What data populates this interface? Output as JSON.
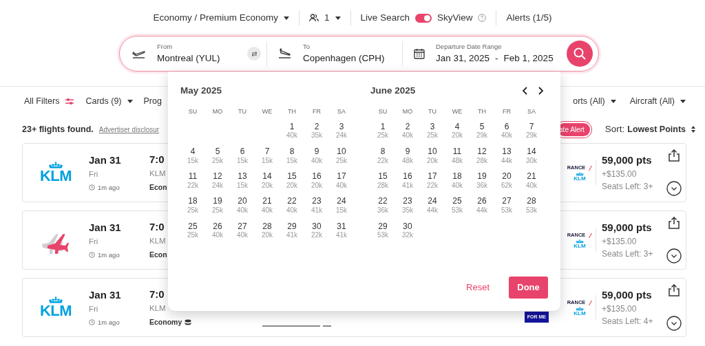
{
  "top_bar": {
    "cabin": "Economy / Premium Economy",
    "passengers": "1",
    "live_search": {
      "label": "Live Search",
      "on": true
    },
    "skyview": "SkyView",
    "alerts": "Alerts (1/5)"
  },
  "search": {
    "from": {
      "label": "From",
      "value": "Montreal (YUL)"
    },
    "to": {
      "label": "To",
      "value": "Copenhagen (CPH)"
    },
    "dates": {
      "label": "Departure Date Range",
      "start": "Jan 31, 2025",
      "separator": "-",
      "end": "Feb 1, 2025"
    }
  },
  "filters_left": [
    {
      "label": "All Filters",
      "kind": "filters"
    },
    {
      "label": "Cards (9)",
      "kind": "dropdown"
    },
    {
      "label": "Prog",
      "kind": "link"
    }
  ],
  "filters_right": [
    {
      "label": "orts (All)",
      "kind": "dropdown"
    },
    {
      "label": "Aircraft (All)",
      "kind": "dropdown"
    }
  ],
  "results": {
    "count": "23+ flights found.",
    "disclosure": "Advertiser disclosur",
    "alert_button": "ate Alert",
    "sort_label": "Sort:",
    "sort_value": "Lowest Points"
  },
  "flights": [
    {
      "kind": "wordmark",
      "logo_text": "KLM",
      "date": "Jan 31",
      "day": "Fri",
      "updated": "1m ago",
      "time": "7:0",
      "airline": "KLM",
      "cabin": "Econ",
      "partner": {
        "top": "RANCE",
        "bottom": "KLM"
      },
      "points": "59,000 pts",
      "fee": "+$135.00",
      "seats": "Seats Left: 3+"
    },
    {
      "kind": "plane",
      "date": "Jan 31",
      "day": "Fri",
      "updated": "1m ago",
      "time": "7:0",
      "airline": "KLM",
      "cabin": "Econ",
      "partner": {
        "top": "RANCE",
        "bottom": "KLM"
      },
      "points": "59,000 pts",
      "fee": "+$135.00",
      "seats": "Seats Left: 3+"
    },
    {
      "kind": "wordmark",
      "logo_text": "KLM",
      "date": "Jan 31",
      "day": "Fri",
      "updated": "1m ago",
      "time": "7:0",
      "airline": "KLM",
      "cabin": "Economy",
      "fare_badge": "FOR ME",
      "partner": {
        "top": "RANCE",
        "bottom": "KLM"
      },
      "points": "59,000 pts",
      "fee": "+$135.00",
      "seats": "Seats Left: 4+"
    }
  ],
  "calendar": {
    "months": [
      {
        "title": "May 2025",
        "weekdays": [
          "SU",
          "MO",
          "TU",
          "WE",
          "TH",
          "FR",
          "SA"
        ],
        "weeks": [
          {
            "kind": "first",
            "days": [
              {
                "day": "1",
                "points": "40k"
              },
              {
                "day": "2",
                "points": "35k"
              },
              {
                "day": "3",
                "points": "24k"
              }
            ]
          },
          [
            {
              "day": "4",
              "points": "15k"
            },
            {
              "day": "5",
              "points": "25k"
            },
            {
              "day": "6",
              "points": "15k"
            },
            {
              "day": "7",
              "points": "15k"
            },
            {
              "day": "8",
              "points": "15k"
            },
            {
              "day": "9",
              "points": "40k"
            },
            {
              "day": "10",
              "points": "25k"
            }
          ],
          [
            {
              "day": "11",
              "points": "22k"
            },
            {
              "day": "12",
              "points": "24k"
            },
            {
              "day": "13",
              "points": "15k"
            },
            {
              "day": "14",
              "points": "20k"
            },
            {
              "day": "15",
              "points": "20k"
            },
            {
              "day": "16",
              "points": "20k"
            },
            {
              "day": "17",
              "points": "40k"
            }
          ],
          [
            {
              "day": "18",
              "points": "25k"
            },
            {
              "day": "19",
              "points": "25k"
            },
            {
              "day": "20",
              "points": "40k"
            },
            {
              "day": "21",
              "points": "40k"
            },
            {
              "day": "22",
              "points": "40k"
            },
            {
              "day": "23",
              "points": "41k"
            },
            {
              "day": "24",
              "points": "15k"
            }
          ],
          [
            {
              "day": "25",
              "points": "25k"
            },
            {
              "day": "26",
              "points": "40k"
            },
            {
              "day": "27",
              "points": "40k"
            },
            {
              "day": "28",
              "points": "20k"
            },
            {
              "day": "29",
              "points": "41k"
            },
            {
              "day": "30",
              "points": "22k"
            },
            {
              "day": "31",
              "points": "41k"
            }
          ]
        ]
      },
      {
        "title": "June 2025",
        "weekdays": [
          "SU",
          "MO",
          "TU",
          "WE",
          "TH",
          "FR",
          "SA"
        ],
        "weeks": [
          [
            {
              "day": "1",
              "points": "25k"
            },
            {
              "day": "2",
              "points": "40k"
            },
            {
              "day": "3",
              "points": "25k"
            },
            {
              "day": "4",
              "points": "20k"
            },
            {
              "day": "5",
              "points": "29k"
            },
            {
              "day": "6",
              "points": "40k"
            },
            {
              "day": "7",
              "points": "29k"
            }
          ],
          [
            {
              "day": "8",
              "points": "22k"
            },
            {
              "day": "9",
              "points": "48k"
            },
            {
              "day": "10",
              "points": "20k"
            },
            {
              "day": "11",
              "points": "48k"
            },
            {
              "day": "12",
              "points": "28k"
            },
            {
              "day": "13",
              "points": "44k"
            },
            {
              "day": "14",
              "points": "30k"
            }
          ],
          [
            {
              "day": "15",
              "points": "28k"
            },
            {
              "day": "16",
              "points": "41k"
            },
            {
              "day": "17",
              "points": "22k"
            },
            {
              "day": "18",
              "points": "40k"
            },
            {
              "day": "19",
              "points": "36k"
            },
            {
              "day": "20",
              "points": "62k"
            },
            {
              "day": "21",
              "points": "40k"
            }
          ],
          [
            {
              "day": "22",
              "points": "36k"
            },
            {
              "day": "23",
              "points": "35k"
            },
            {
              "day": "24",
              "points": "44k"
            },
            {
              "day": "25",
              "points": "53k"
            },
            {
              "day": "26",
              "points": "44k"
            },
            {
              "day": "27",
              "points": "53k"
            },
            {
              "day": "28",
              "points": "53k"
            }
          ],
          {
            "kind": "last",
            "days": [
              {
                "day": "29",
                "points": "53k"
              },
              {
                "day": "30",
                "points": "32k"
              }
            ]
          }
        ]
      }
    ],
    "reset": "Reset",
    "done": "Done"
  }
}
